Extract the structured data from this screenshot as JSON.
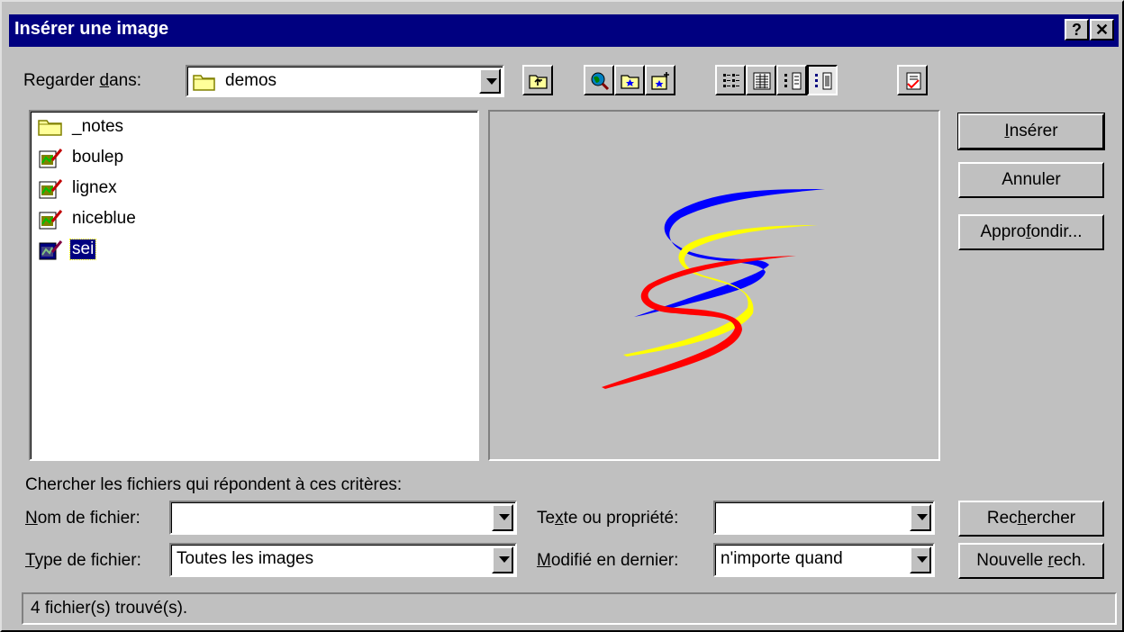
{
  "dialog": {
    "title": "Insérer une image",
    "help_button": "?",
    "close_button": "✕"
  },
  "look_in": {
    "label_before": "Regarder ",
    "label_underline": "d",
    "label_after": "ans:",
    "value": "demos"
  },
  "toolbar": {
    "buttons": [
      "up-one-level",
      "search-web",
      "favorites",
      "add-to-favorites",
      "list-view",
      "details-view",
      "properties-view",
      "preview-view",
      "commands-settings"
    ],
    "pressed": "preview-view"
  },
  "files": [
    {
      "name": "_notes",
      "type": "folder"
    },
    {
      "name": "boulep",
      "type": "image"
    },
    {
      "name": "lignex",
      "type": "image"
    },
    {
      "name": "niceblue",
      "type": "image"
    },
    {
      "name": "sei",
      "type": "image",
      "selected": true
    }
  ],
  "buttons": {
    "insert_u": "I",
    "insert_rest": "nsérer",
    "cancel": "Annuler",
    "advanced_before": "Appro",
    "advanced_u": "f",
    "advanced_after": "ondir...",
    "search_before": "Rec",
    "search_u": "h",
    "search_after": "ercher",
    "new_search_before": "Nouvelle ",
    "new_search_u": "r",
    "new_search_after": "ech."
  },
  "criteria": {
    "heading": "Chercher les fichiers qui répondent à ces critères:",
    "filename_u": "N",
    "filename_rest": "om de fichier:",
    "filename_value": "",
    "filetype_u": "T",
    "filetype_rest": "ype de fichier:",
    "filetype_value": "Toutes les images",
    "text_before": "Te",
    "text_u": "x",
    "text_after": "te ou propriété:",
    "text_value": "",
    "modified_u": "M",
    "modified_rest": "odifié en dernier:",
    "modified_value": "n'importe quand"
  },
  "status": {
    "text": "4 fichier(s) trouvé(s)."
  },
  "colors": {
    "titlebar": "#000080",
    "face": "#c0c0c0",
    "selection": "#000080",
    "preview_blue": "#0000ff",
    "preview_yellow": "#ffff00",
    "preview_red": "#ff0000"
  }
}
